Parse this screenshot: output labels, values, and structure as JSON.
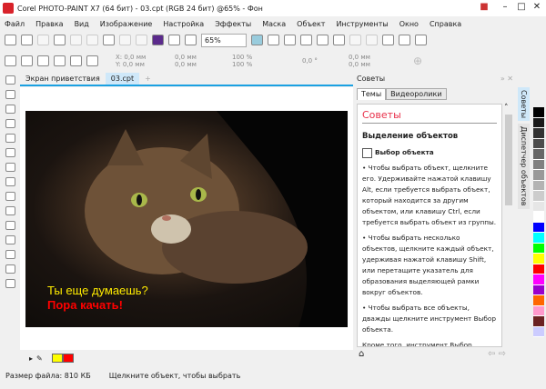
{
  "title": "Corel PHOTO-PAINT X7 (64 бит) - 03.cpt (RGB 24 бит) @65% - Фон",
  "menu": [
    "Файл",
    "Правка",
    "Вид",
    "Изображение",
    "Настройка",
    "Эффекты",
    "Маска",
    "Объект",
    "Инструменты",
    "Окно",
    "Справка"
  ],
  "toolbar": {
    "zoom": "65%"
  },
  "property_bar": {
    "x": "X: 0,0 мм",
    "y": "Y: 0,0 мм",
    "w": "0,0 мм",
    "h": "0,0 мм",
    "sx": "100 %",
    "sy": "100 %",
    "angle": "0,0 °",
    "cx": "0,0 мм",
    "cy": "0,0 мм"
  },
  "tabs": [
    "Экран приветствия",
    "03.cpt"
  ],
  "canvas": {
    "line1": "Ты еще думаешь?",
    "line2": "Пора качать!"
  },
  "status": {
    "size": "Размер файла: 810 КБ",
    "hint": "Щелкните объект, чтобы выбрать"
  },
  "colors": {
    "fill": "#ffff00",
    "outline": "#ff0000"
  },
  "dock": {
    "title": "Советы",
    "tabs": [
      "Темы",
      "Видеоролики"
    ],
    "heading": "Советы",
    "section": "Выделение объектов",
    "tool": "Выбор объекта",
    "bullets": [
      "• Чтобы выбрать объект, щелкните его. Удерживайте нажатой клавишу Alt, если требуется выбрать объект, который находится за другим объектом, или клавишу Ctrl, если требуется выбрать объект из группы.",
      "• Чтобы выбрать несколько объектов, щелкните каждый объект, удерживая нажатой клавишу Shift, или перетащите указатель для образования выделяющей рамки вокруг объектов.",
      "• Чтобы выбрать все объекты, дважды щелкните инструмент Выбор объекта."
    ],
    "extra": "Кроме того, инструмент Выбор объекта можно использовать, чтобы применять"
  },
  "vertical_tabs": [
    "Советы",
    "Диспетчер объектов"
  ],
  "palette": [
    "#000000",
    "#1a1a1a",
    "#333333",
    "#4d4d4d",
    "#666666",
    "#808080",
    "#999999",
    "#b3b3b3",
    "#cccccc",
    "#e6e6e6",
    "#ffffff",
    "#0000ff",
    "#00ffff",
    "#00ff00",
    "#ffff00",
    "#ff0000",
    "#ff00ff",
    "#9900cc",
    "#ff6600",
    "#ff99cc",
    "#6b2222",
    "#ccccff"
  ]
}
